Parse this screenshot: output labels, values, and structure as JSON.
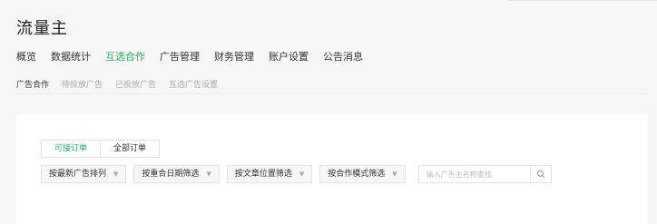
{
  "app": {
    "title": "流量主"
  },
  "nav": {
    "items": [
      {
        "label": "概览"
      },
      {
        "label": "数据统计"
      },
      {
        "label": "互选合作"
      },
      {
        "label": "广告管理"
      },
      {
        "label": "财务管理"
      },
      {
        "label": "账户设置"
      },
      {
        "label": "公告消息"
      }
    ],
    "active": "互选合作"
  },
  "subnav": {
    "items": [
      {
        "label": "广告合作"
      },
      {
        "label": "待投放广告"
      },
      {
        "label": "已投放广告"
      },
      {
        "label": "互选广告设置"
      }
    ],
    "active": "广告合作"
  },
  "tabs": {
    "items": [
      {
        "label": "可接订单"
      },
      {
        "label": "全部订单"
      }
    ],
    "active": "可接订单"
  },
  "filters": [
    {
      "label": "按最新广告排列"
    },
    {
      "label": "按重合日期筛选"
    },
    {
      "label": "按文章位置筛选"
    },
    {
      "label": "按合作模式筛选"
    }
  ],
  "search": {
    "placeholder": "输入广告主名称查找",
    "icon": "search-icon"
  },
  "colors": {
    "accent": "#2aae67"
  }
}
